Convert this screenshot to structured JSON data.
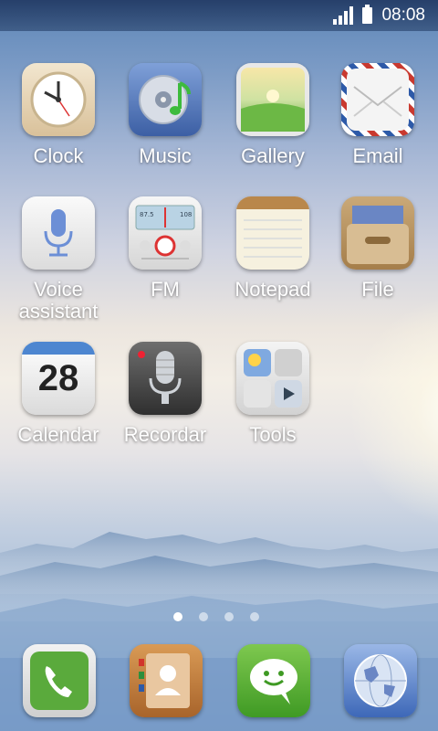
{
  "status": {
    "time": "08:08",
    "signal_bars": 4,
    "battery_level": 1.0
  },
  "apps": [
    {
      "label": "Clock",
      "icon": "clock-icon"
    },
    {
      "label": "Music",
      "icon": "music-icon"
    },
    {
      "label": "Gallery",
      "icon": "gallery-icon"
    },
    {
      "label": "Email",
      "icon": "email-icon"
    },
    {
      "label": "Voice\nassistant",
      "icon": "microphone-icon"
    },
    {
      "label": "FM",
      "icon": "radio-icon"
    },
    {
      "label": "Notepad",
      "icon": "notepad-icon"
    },
    {
      "label": "File",
      "icon": "folder-icon"
    },
    {
      "label": "Calendar",
      "icon": "calendar-icon"
    },
    {
      "label": "Recordar",
      "icon": "recorder-icon"
    },
    {
      "label": "Tools",
      "icon": "tools-icon"
    }
  ],
  "calendar_day": "28",
  "fm_dial": {
    "low": "87.5",
    "high": "108"
  },
  "pages": {
    "count": 4,
    "current": 1
  },
  "dock": [
    {
      "icon": "phone-icon"
    },
    {
      "icon": "contacts-icon"
    },
    {
      "icon": "messaging-icon"
    },
    {
      "icon": "browser-globe-icon"
    }
  ]
}
